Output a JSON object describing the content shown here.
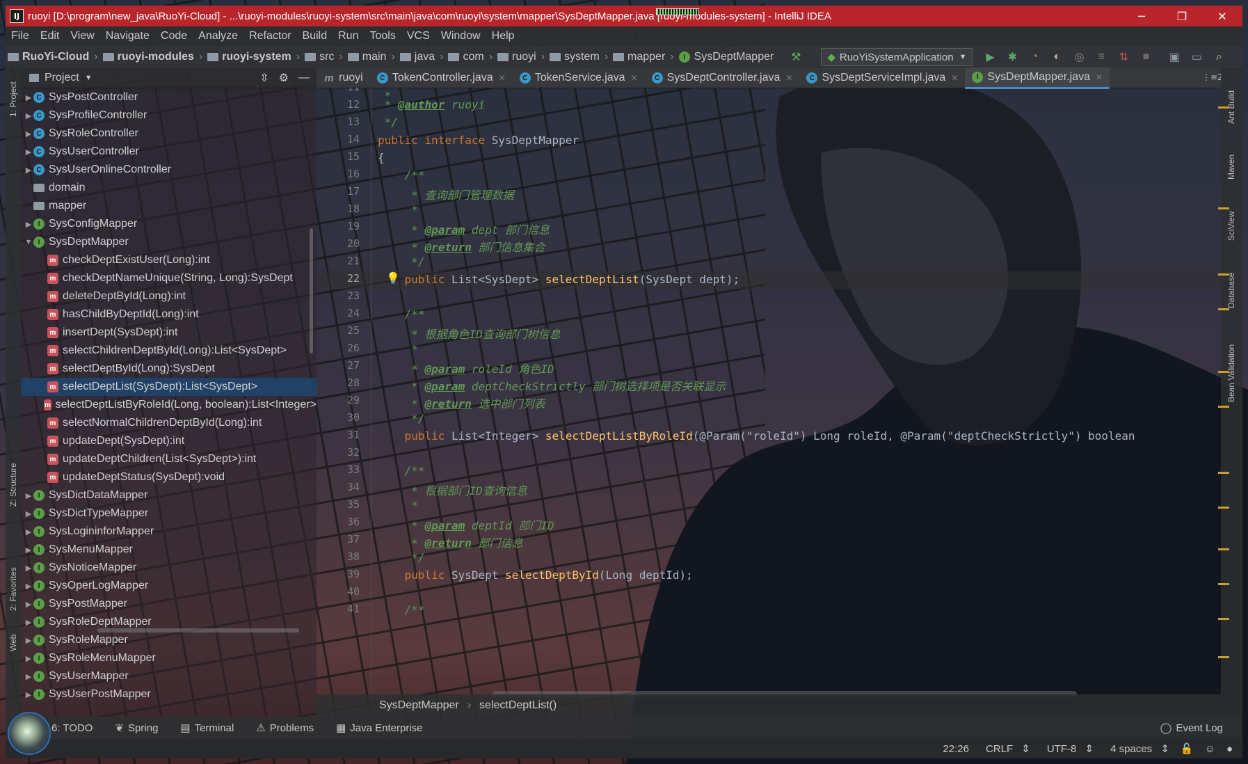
{
  "window": {
    "title": "ruoyi [D:\\program\\new_java\\RuoYi-Cloud] - ...\\ruoyi-modules\\ruoyi-system\\src\\main\\java\\com\\ruoyi\\system\\mapper\\SysDeptMapper.java [ruoyi-modules-system] - IntelliJ IDEA",
    "minimize": "─",
    "restore": "❐",
    "close": "✕"
  },
  "menu": [
    "File",
    "Edit",
    "View",
    "Navigate",
    "Code",
    "Analyze",
    "Refactor",
    "Build",
    "Run",
    "Tools",
    "VCS",
    "Window",
    "Help"
  ],
  "nav": {
    "crumbs": [
      "RuoYi-Cloud",
      "ruoyi-modules",
      "ruoyi-system",
      "src",
      "main",
      "java",
      "com",
      "ruoyi",
      "system",
      "mapper",
      "SysDeptMapper"
    ],
    "run_config": "RuoYiSystemApplication"
  },
  "left_strip": {
    "project": "1: Project",
    "structure": "Z: Structure",
    "favorites": "2: Favorites",
    "web": "Web"
  },
  "right_strip": {
    "ant": "Ant Build",
    "maven": "Maven",
    "sciview": "SciView",
    "database": "Database",
    "bean": "Bean Validation"
  },
  "project": {
    "title": "Project",
    "rows": [
      {
        "label": "SysPostController",
        "icon": "c",
        "indent": 1,
        "arrow": "▶"
      },
      {
        "label": "SysProfileController",
        "icon": "c",
        "indent": 1,
        "arrow": "▶"
      },
      {
        "label": "SysRoleController",
        "icon": "c",
        "indent": 1,
        "arrow": "▶"
      },
      {
        "label": "SysUserController",
        "icon": "c",
        "indent": 1,
        "arrow": "▶"
      },
      {
        "label": "SysUserOnlineController",
        "icon": "c",
        "indent": 1,
        "arrow": "▶"
      },
      {
        "label": "domain",
        "icon": "folder",
        "indent": 0,
        "arrow": ""
      },
      {
        "label": "mapper",
        "icon": "folder",
        "indent": 0,
        "arrow": ""
      },
      {
        "label": "SysConfigMapper",
        "icon": "i",
        "indent": 1,
        "arrow": "▶"
      },
      {
        "label": "SysDeptMapper",
        "icon": "i",
        "indent": 1,
        "arrow": "▼"
      },
      {
        "label": "checkDeptExistUser(Long):int",
        "icon": "m",
        "indent": 2,
        "arrow": ""
      },
      {
        "label": "checkDeptNameUnique(String, Long):SysDept",
        "icon": "m",
        "indent": 2,
        "arrow": ""
      },
      {
        "label": "deleteDeptById(Long):int",
        "icon": "m",
        "indent": 2,
        "arrow": ""
      },
      {
        "label": "hasChildByDeptId(Long):int",
        "icon": "m",
        "indent": 2,
        "arrow": ""
      },
      {
        "label": "insertDept(SysDept):int",
        "icon": "m",
        "indent": 2,
        "arrow": ""
      },
      {
        "label": "selectChildrenDeptById(Long):List<SysDept>",
        "icon": "m",
        "indent": 2,
        "arrow": ""
      },
      {
        "label": "selectDeptById(Long):SysDept",
        "icon": "m",
        "indent": 2,
        "arrow": ""
      },
      {
        "label": "selectDeptList(SysDept):List<SysDept>",
        "icon": "m",
        "indent": 2,
        "arrow": "",
        "selected": true
      },
      {
        "label": "selectDeptListByRoleId(Long, boolean):List<Integer>",
        "icon": "m",
        "indent": 2,
        "arrow": ""
      },
      {
        "label": "selectNormalChildrenDeptById(Long):int",
        "icon": "m",
        "indent": 2,
        "arrow": ""
      },
      {
        "label": "updateDept(SysDept):int",
        "icon": "m",
        "indent": 2,
        "arrow": ""
      },
      {
        "label": "updateDeptChildren(List<SysDept>):int",
        "icon": "m",
        "indent": 2,
        "arrow": ""
      },
      {
        "label": "updateDeptStatus(SysDept):void",
        "icon": "m",
        "indent": 2,
        "arrow": ""
      },
      {
        "label": "SysDictDataMapper",
        "icon": "i",
        "indent": 1,
        "arrow": "▶"
      },
      {
        "label": "SysDictTypeMapper",
        "icon": "i",
        "indent": 1,
        "arrow": "▶"
      },
      {
        "label": "SysLogininforMapper",
        "icon": "i",
        "indent": 1,
        "arrow": "▶"
      },
      {
        "label": "SysMenuMapper",
        "icon": "i",
        "indent": 1,
        "arrow": "▶"
      },
      {
        "label": "SysNoticeMapper",
        "icon": "i",
        "indent": 1,
        "arrow": "▶"
      },
      {
        "label": "SysOperLogMapper",
        "icon": "i",
        "indent": 1,
        "arrow": "▶"
      },
      {
        "label": "SysPostMapper",
        "icon": "i",
        "indent": 1,
        "arrow": "▶"
      },
      {
        "label": "SysRoleDeptMapper",
        "icon": "i",
        "indent": 1,
        "arrow": "▶"
      },
      {
        "label": "SysRoleMapper",
        "icon": "i",
        "indent": 1,
        "arrow": "▶"
      },
      {
        "label": "SysRoleMenuMapper",
        "icon": "i",
        "indent": 1,
        "arrow": "▶"
      },
      {
        "label": "SysUserMapper",
        "icon": "i",
        "indent": 1,
        "arrow": "▶"
      },
      {
        "label": "SysUserPostMapper",
        "icon": "i",
        "indent": 1,
        "arrow": "▶"
      }
    ]
  },
  "tabs": [
    {
      "label": "ruoyi",
      "icon": "m"
    },
    {
      "label": "TokenController.java",
      "icon": "c"
    },
    {
      "label": "TokenService.java",
      "icon": "c"
    },
    {
      "label": "SysDeptController.java",
      "icon": "c"
    },
    {
      "label": "SysDeptServiceImpl.java",
      "icon": "c"
    },
    {
      "label": "SysDeptMapper.java",
      "icon": "i",
      "active": true
    }
  ],
  "tabs_more": "⋮≡2",
  "code": {
    "line_numbers": [
      "11",
      "12",
      "13",
      "14",
      "15",
      "16",
      "17",
      "18",
      "19",
      "20",
      "21",
      "22",
      "23",
      "24",
      "25",
      "26",
      "27",
      "28",
      "29",
      "30",
      "31",
      "32",
      "33",
      "34",
      "35",
      "36",
      "37",
      "38",
      "39",
      "40",
      "41"
    ],
    "author_tag": "@author",
    "author": "ruoyi",
    "interface_decl": "SysDeptMapper",
    "c1_desc": "查询部门管理数据",
    "c1_param": "dept 部门信息",
    "c1_return": "部门信息集合",
    "m1_name": "selectDeptList",
    "m1_ret": "List<SysDept>",
    "m1_args": "(SysDept dept);",
    "c2_desc": "根据角色ID查询部门树信息",
    "c2_param1": "roleId 角色ID",
    "c2_param2": "deptCheckStrictly 部门树选择项是否关联显示",
    "c2_return": "选中部门列表",
    "m2_name": "selectDeptListByRoleId",
    "m2_ret": "List<Integer>",
    "m2_args_a": "(@Param(\"roleId\") Long roleId, @Param(\"deptCheckStrictly\") boolean",
    "c3_desc": "根据部门ID查询信息",
    "c3_param": "deptId 部门ID",
    "c3_return": "部门信息",
    "m3_name": "selectDeptById",
    "m3_ret": "SysDept",
    "m3_args": "(Long deptId);",
    "param_tag": "@param",
    "return_tag": "@return"
  },
  "breadcrumb": {
    "cls": "SysDeptMapper",
    "method": "selectDeptList()"
  },
  "bottom_tools": [
    "6: TODO",
    "Spring",
    "Terminal",
    "Problems",
    "Java Enterprise"
  ],
  "event_log": "Event Log",
  "status": {
    "pos": "22:26",
    "eol": "CRLF",
    "enc": "UTF-8",
    "indent": "4 spaces"
  },
  "colors": {
    "titlebar": "#b8262b",
    "selection": "#214269",
    "keyword": "#cc7832",
    "comment": "#629755",
    "method": "#ffc66d"
  }
}
